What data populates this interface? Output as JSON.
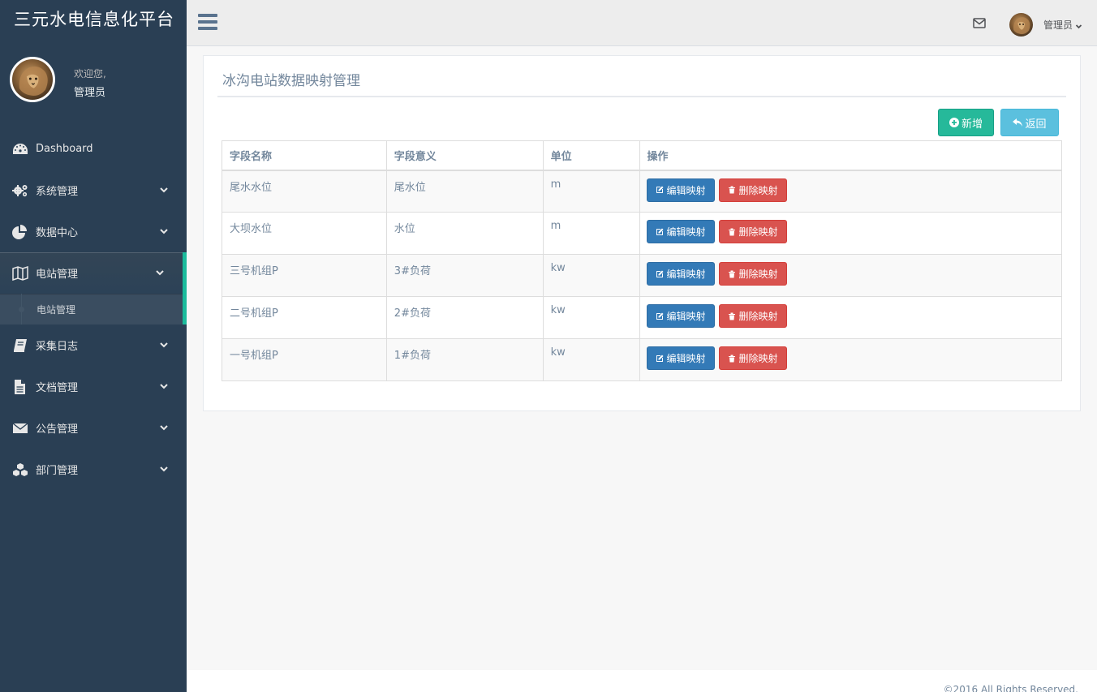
{
  "app": {
    "brand": "三元水电信息化平台"
  },
  "profile": {
    "welcome": "欢迎您,",
    "name": "管理员",
    "avatar_icon": "lion-avatar"
  },
  "sidebar": {
    "items": [
      {
        "label": "Dashboard",
        "icon": "dashboard-icon",
        "has_children": false
      },
      {
        "label": "系统管理",
        "icon": "gears-icon",
        "has_children": true
      },
      {
        "label": "数据中心",
        "icon": "pie-chart-icon",
        "has_children": true
      },
      {
        "label": "电站管理",
        "icon": "map-icon",
        "has_children": true,
        "active": true,
        "children": [
          {
            "label": "电站管理"
          }
        ]
      },
      {
        "label": "采集日志",
        "icon": "book-icon",
        "has_children": true
      },
      {
        "label": "文档管理",
        "icon": "file-icon",
        "has_children": true
      },
      {
        "label": "公告管理",
        "icon": "envelope-icon",
        "has_children": true
      },
      {
        "label": "部门管理",
        "icon": "cubes-icon",
        "has_children": true
      }
    ]
  },
  "topnav": {
    "user_name": "管理员",
    "mail_icon": "envelope-o-icon",
    "menu_icon": "bars-icon"
  },
  "panel": {
    "title": "冰沟电站数据映射管理",
    "add_label": "新增",
    "back_label": "返回"
  },
  "table": {
    "headers": [
      "字段名称",
      "字段意义",
      "单位",
      "操作"
    ],
    "edit_label": "编辑映射",
    "delete_label": "删除映射",
    "rows": [
      {
        "name": "尾水水位",
        "meaning": "尾水位",
        "unit": "m"
      },
      {
        "name": "大坝水位",
        "meaning": "水位",
        "unit": "m"
      },
      {
        "name": "三号机组P",
        "meaning": "3#负荷",
        "unit": "kw"
      },
      {
        "name": "二号机组P",
        "meaning": "2#负荷",
        "unit": "kw"
      },
      {
        "name": "一号机组P",
        "meaning": "1#负荷",
        "unit": "kw"
      }
    ]
  },
  "footer": {
    "copyright": "©2016 All Rights Reserved."
  },
  "colors": {
    "sidebar_bg": "#2A3F54",
    "accent_green": "#1ABB9C",
    "btn_add": "#26B99A",
    "btn_back": "#5BC0DE",
    "btn_edit": "#337AB7",
    "btn_delete": "#D9534F"
  }
}
